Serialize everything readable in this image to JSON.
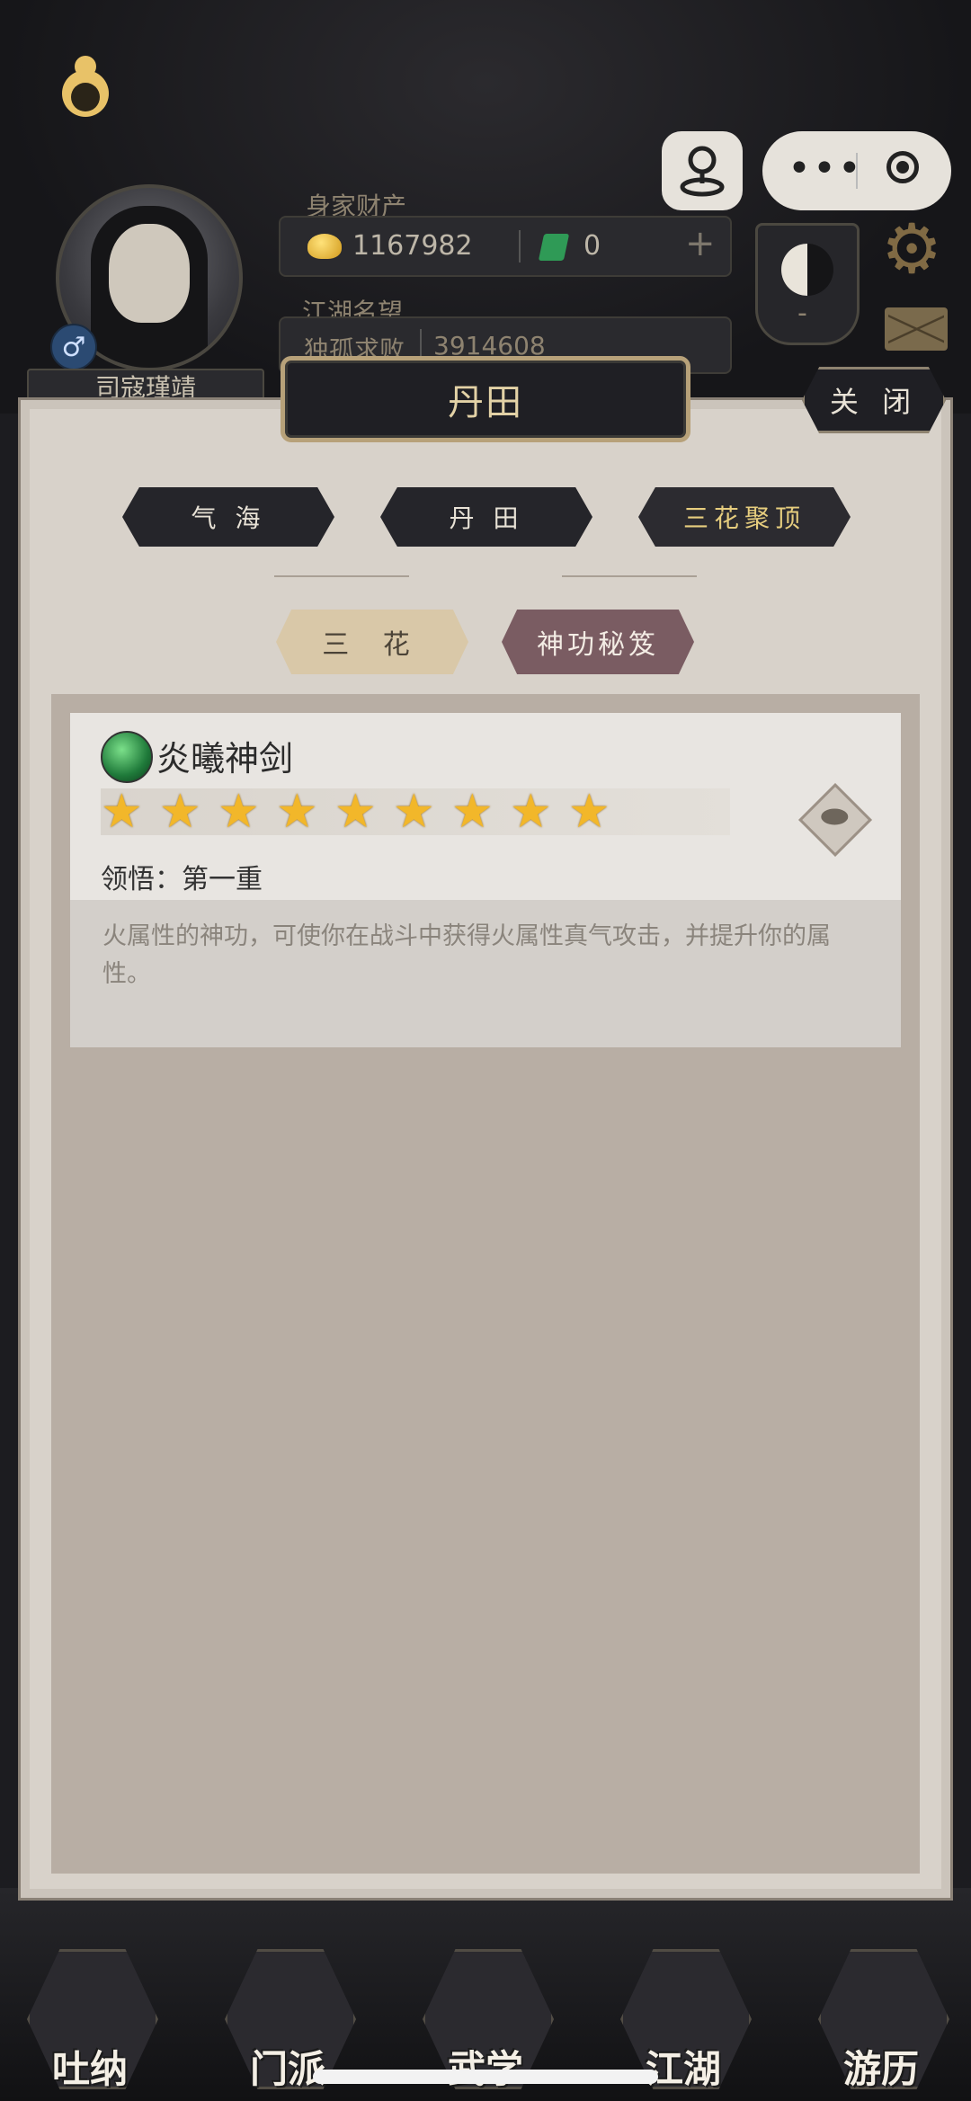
{
  "hud": {
    "player_name": "司寇瑾靖",
    "wealth_label": "身家财产",
    "gold_value": "1167982",
    "jade_value": "0",
    "fame_label": "江湖名望",
    "fame_title": "独孤求败",
    "fame_value": "3914608",
    "gender_symbol": "♂",
    "banner_value": "-"
  },
  "panel": {
    "title": "丹田",
    "close_label": "关 闭",
    "tabs": [
      {
        "label": "气 海",
        "active": false
      },
      {
        "label": "丹 田",
        "active": false
      },
      {
        "label": "三花聚顶",
        "active": true
      }
    ],
    "sub_tabs": [
      {
        "label": "三 花"
      },
      {
        "label": "神功秘笈"
      }
    ]
  },
  "skill": {
    "name": "炎曦神剑",
    "star_count": 9,
    "star_glyph": "★",
    "enlightenment": "领悟：第一重",
    "description": "火属性的神功，可使你在战斗中获得火属性真气攻击，并提升你的属性。"
  },
  "bottom_nav": [
    {
      "label": "吐纳"
    },
    {
      "label": "门派"
    },
    {
      "label": "武学"
    },
    {
      "label": "江湖"
    },
    {
      "label": "游历"
    }
  ],
  "colors": {
    "accent_gold": "#e3d2a6",
    "active_tab_text": "#e6cd7e",
    "selected_subtab": "#7a5c62",
    "star": "#f2b72a"
  }
}
